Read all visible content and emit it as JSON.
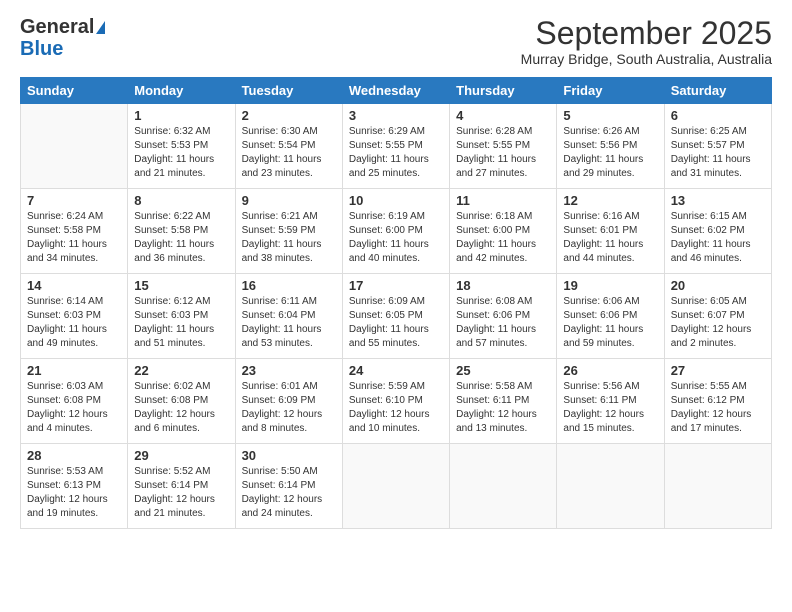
{
  "logo": {
    "general": "General",
    "blue": "Blue"
  },
  "title": "September 2025",
  "location": "Murray Bridge, South Australia, Australia",
  "days_of_week": [
    "Sunday",
    "Monday",
    "Tuesday",
    "Wednesday",
    "Thursday",
    "Friday",
    "Saturday"
  ],
  "weeks": [
    [
      {
        "day": "",
        "sunrise": "",
        "sunset": "",
        "daylight": ""
      },
      {
        "day": "1",
        "sunrise": "Sunrise: 6:32 AM",
        "sunset": "Sunset: 5:53 PM",
        "daylight": "Daylight: 11 hours and 21 minutes."
      },
      {
        "day": "2",
        "sunrise": "Sunrise: 6:30 AM",
        "sunset": "Sunset: 5:54 PM",
        "daylight": "Daylight: 11 hours and 23 minutes."
      },
      {
        "day": "3",
        "sunrise": "Sunrise: 6:29 AM",
        "sunset": "Sunset: 5:55 PM",
        "daylight": "Daylight: 11 hours and 25 minutes."
      },
      {
        "day": "4",
        "sunrise": "Sunrise: 6:28 AM",
        "sunset": "Sunset: 5:55 PM",
        "daylight": "Daylight: 11 hours and 27 minutes."
      },
      {
        "day": "5",
        "sunrise": "Sunrise: 6:26 AM",
        "sunset": "Sunset: 5:56 PM",
        "daylight": "Daylight: 11 hours and 29 minutes."
      },
      {
        "day": "6",
        "sunrise": "Sunrise: 6:25 AM",
        "sunset": "Sunset: 5:57 PM",
        "daylight": "Daylight: 11 hours and 31 minutes."
      }
    ],
    [
      {
        "day": "7",
        "sunrise": "Sunrise: 6:24 AM",
        "sunset": "Sunset: 5:58 PM",
        "daylight": "Daylight: 11 hours and 34 minutes."
      },
      {
        "day": "8",
        "sunrise": "Sunrise: 6:22 AM",
        "sunset": "Sunset: 5:58 PM",
        "daylight": "Daylight: 11 hours and 36 minutes."
      },
      {
        "day": "9",
        "sunrise": "Sunrise: 6:21 AM",
        "sunset": "Sunset: 5:59 PM",
        "daylight": "Daylight: 11 hours and 38 minutes."
      },
      {
        "day": "10",
        "sunrise": "Sunrise: 6:19 AM",
        "sunset": "Sunset: 6:00 PM",
        "daylight": "Daylight: 11 hours and 40 minutes."
      },
      {
        "day": "11",
        "sunrise": "Sunrise: 6:18 AM",
        "sunset": "Sunset: 6:00 PM",
        "daylight": "Daylight: 11 hours and 42 minutes."
      },
      {
        "day": "12",
        "sunrise": "Sunrise: 6:16 AM",
        "sunset": "Sunset: 6:01 PM",
        "daylight": "Daylight: 11 hours and 44 minutes."
      },
      {
        "day": "13",
        "sunrise": "Sunrise: 6:15 AM",
        "sunset": "Sunset: 6:02 PM",
        "daylight": "Daylight: 11 hours and 46 minutes."
      }
    ],
    [
      {
        "day": "14",
        "sunrise": "Sunrise: 6:14 AM",
        "sunset": "Sunset: 6:03 PM",
        "daylight": "Daylight: 11 hours and 49 minutes."
      },
      {
        "day": "15",
        "sunrise": "Sunrise: 6:12 AM",
        "sunset": "Sunset: 6:03 PM",
        "daylight": "Daylight: 11 hours and 51 minutes."
      },
      {
        "day": "16",
        "sunrise": "Sunrise: 6:11 AM",
        "sunset": "Sunset: 6:04 PM",
        "daylight": "Daylight: 11 hours and 53 minutes."
      },
      {
        "day": "17",
        "sunrise": "Sunrise: 6:09 AM",
        "sunset": "Sunset: 6:05 PM",
        "daylight": "Daylight: 11 hours and 55 minutes."
      },
      {
        "day": "18",
        "sunrise": "Sunrise: 6:08 AM",
        "sunset": "Sunset: 6:06 PM",
        "daylight": "Daylight: 11 hours and 57 minutes."
      },
      {
        "day": "19",
        "sunrise": "Sunrise: 6:06 AM",
        "sunset": "Sunset: 6:06 PM",
        "daylight": "Daylight: 11 hours and 59 minutes."
      },
      {
        "day": "20",
        "sunrise": "Sunrise: 6:05 AM",
        "sunset": "Sunset: 6:07 PM",
        "daylight": "Daylight: 12 hours and 2 minutes."
      }
    ],
    [
      {
        "day": "21",
        "sunrise": "Sunrise: 6:03 AM",
        "sunset": "Sunset: 6:08 PM",
        "daylight": "Daylight: 12 hours and 4 minutes."
      },
      {
        "day": "22",
        "sunrise": "Sunrise: 6:02 AM",
        "sunset": "Sunset: 6:08 PM",
        "daylight": "Daylight: 12 hours and 6 minutes."
      },
      {
        "day": "23",
        "sunrise": "Sunrise: 6:01 AM",
        "sunset": "Sunset: 6:09 PM",
        "daylight": "Daylight: 12 hours and 8 minutes."
      },
      {
        "day": "24",
        "sunrise": "Sunrise: 5:59 AM",
        "sunset": "Sunset: 6:10 PM",
        "daylight": "Daylight: 12 hours and 10 minutes."
      },
      {
        "day": "25",
        "sunrise": "Sunrise: 5:58 AM",
        "sunset": "Sunset: 6:11 PM",
        "daylight": "Daylight: 12 hours and 13 minutes."
      },
      {
        "day": "26",
        "sunrise": "Sunrise: 5:56 AM",
        "sunset": "Sunset: 6:11 PM",
        "daylight": "Daylight: 12 hours and 15 minutes."
      },
      {
        "day": "27",
        "sunrise": "Sunrise: 5:55 AM",
        "sunset": "Sunset: 6:12 PM",
        "daylight": "Daylight: 12 hours and 17 minutes."
      }
    ],
    [
      {
        "day": "28",
        "sunrise": "Sunrise: 5:53 AM",
        "sunset": "Sunset: 6:13 PM",
        "daylight": "Daylight: 12 hours and 19 minutes."
      },
      {
        "day": "29",
        "sunrise": "Sunrise: 5:52 AM",
        "sunset": "Sunset: 6:14 PM",
        "daylight": "Daylight: 12 hours and 21 minutes."
      },
      {
        "day": "30",
        "sunrise": "Sunrise: 5:50 AM",
        "sunset": "Sunset: 6:14 PM",
        "daylight": "Daylight: 12 hours and 24 minutes."
      },
      {
        "day": "",
        "sunrise": "",
        "sunset": "",
        "daylight": ""
      },
      {
        "day": "",
        "sunrise": "",
        "sunset": "",
        "daylight": ""
      },
      {
        "day": "",
        "sunrise": "",
        "sunset": "",
        "daylight": ""
      },
      {
        "day": "",
        "sunrise": "",
        "sunset": "",
        "daylight": ""
      }
    ]
  ]
}
